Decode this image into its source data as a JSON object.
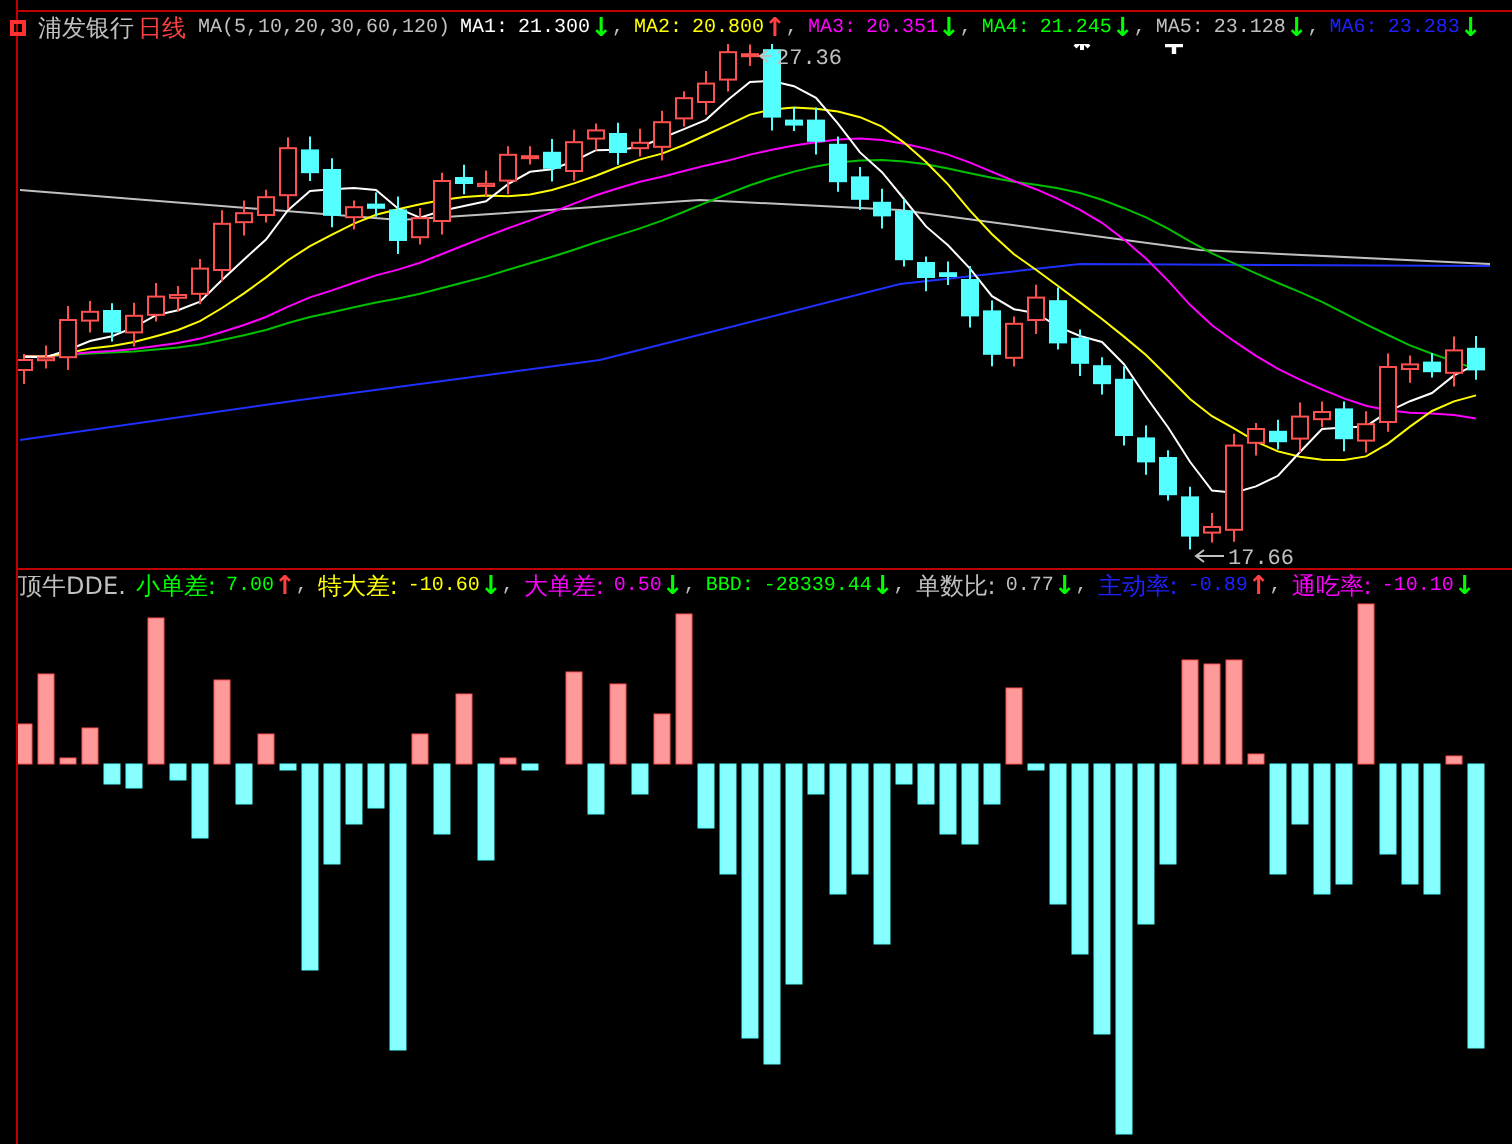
{
  "price_header": {
    "title": "浦发银行",
    "period": "日线",
    "indicator": "MA(5,10,20,30,60,120)",
    "values": [
      {
        "label": "MA1:",
        "value": "21.300",
        "arrow": {
          "text": "↓",
          "color": "#00ff00"
        },
        "color": "#ffffff",
        "separator": ","
      },
      {
        "label": "MA2:",
        "value": "20.800",
        "arrow": {
          "text": "↑",
          "color": "#ff4040"
        },
        "color": "#ffff00",
        "separator": ","
      },
      {
        "label": "MA3:",
        "value": "20.351",
        "arrow": {
          "text": "↓",
          "color": "#00ff00"
        },
        "color": "#ff00ff",
        "separator": ","
      },
      {
        "label": "MA4:",
        "value": "21.245",
        "arrow": {
          "text": "↓",
          "color": "#00ff00"
        },
        "color": "#00ff00",
        "separator": ","
      },
      {
        "label": "MA5:",
        "value": "23.128",
        "arrow": {
          "text": "↓",
          "color": "#00ff00"
        },
        "color": "#c0c0c0",
        "separator": ","
      },
      {
        "label": "MA6:",
        "value": "23.283",
        "arrow": {
          "text": "↓",
          "color": "#00ff00"
        },
        "color": "#2020ff"
      }
    ]
  },
  "price_chart": {
    "high_label": "27.36",
    "low_label": "17.66"
  },
  "dde_header": {
    "title": "顶牛DDE.",
    "values": [
      {
        "label": "小单差:",
        "value": "7.00",
        "arrow": {
          "text": "↑",
          "color": "#ff4040"
        },
        "color": "#00ff00",
        "separator": ","
      },
      {
        "label": "特大差:",
        "value": "-10.60",
        "arrow": {
          "text": "↓",
          "color": "#00ff00"
        },
        "color": "#ffff00",
        "separator": ","
      },
      {
        "label": "大单差:",
        "value": "0.50",
        "arrow": {
          "text": "↓",
          "color": "#00ff00"
        },
        "color": "#ff00ff",
        "separator": ","
      },
      {
        "label": "BBD:",
        "value": "-28339.44",
        "arrow": {
          "text": "↓",
          "color": "#00ff00"
        },
        "color": "#00ff00",
        "separator": ","
      },
      {
        "label": "单数比:",
        "value": "0.77",
        "arrow": {
          "text": "↓",
          "color": "#00ff00"
        },
        "color": "#c0c0c0",
        "separator": ","
      },
      {
        "label": "主动率:",
        "value": "-0.89",
        "arrow": {
          "text": "↑",
          "color": "#ff4040"
        },
        "color": "#2020ff",
        "separator": ","
      },
      {
        "label": "通吃率:",
        "value": "-10.10",
        "arrow": {
          "text": "↓",
          "color": "#00ff00"
        },
        "color": "#ff00ff"
      }
    ]
  }
}
